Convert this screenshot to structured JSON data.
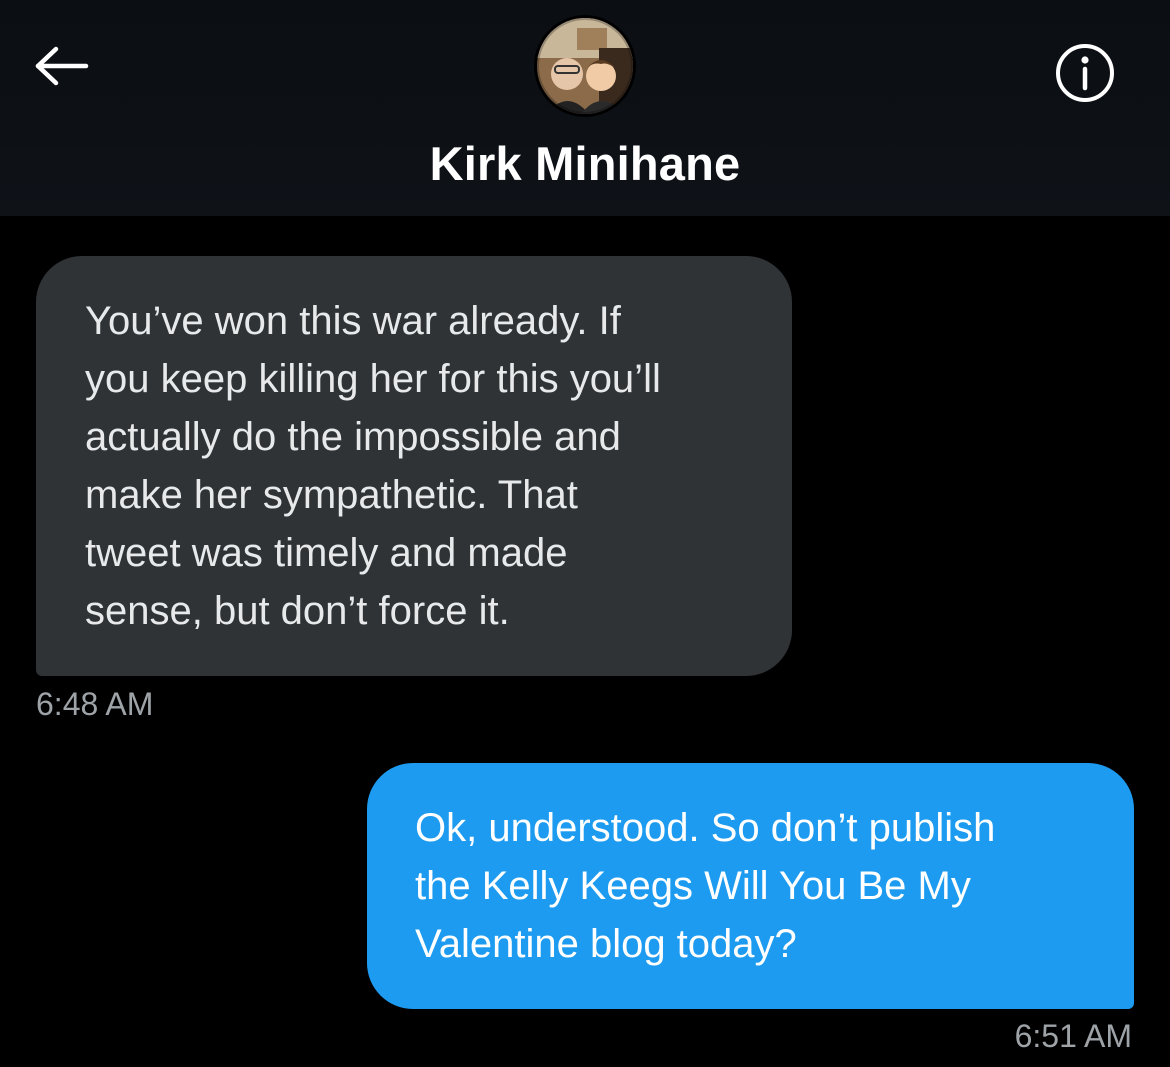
{
  "header": {
    "contact_name": "Kirk Minihane",
    "back_icon": "arrow-left-icon",
    "info_icon": "info-circle-icon",
    "avatar_icon": "contact-avatar"
  },
  "messages": [
    {
      "direction": "incoming",
      "text": "You’ve won this war already. If\nyou keep killing her for this you’ll\nactually do the impossible and\nmake her sympathetic. That\ntweet was timely and made\nsense, but don’t force it.",
      "time": "6:48 AM"
    },
    {
      "direction": "outgoing",
      "text": "Ok, understood. So don’t publish\nthe Kelly Keegs Will You Be My\nValentine blog today?",
      "time": "6:51 AM"
    }
  ],
  "colors": {
    "background": "#000000",
    "incoming_bubble": "#2f3336",
    "outgoing_bubble": "#1d9bf0",
    "timestamp": "#9ea3a8"
  }
}
